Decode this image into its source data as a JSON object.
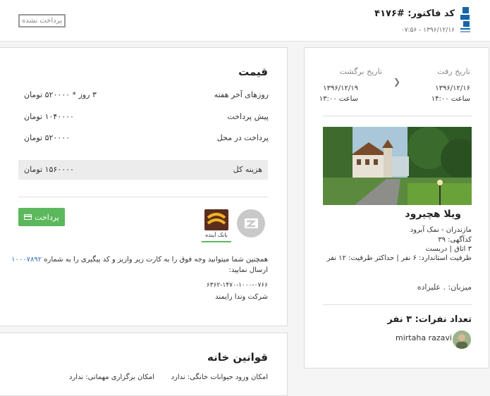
{
  "header": {
    "invoice_title": "کد فاکتور: #۴۱۷۶",
    "invoice_date": "۱۳۹۶/۱۲/۱۶ - ۰۷:۵۶",
    "status": "پرداخت نشده"
  },
  "price": {
    "title": "قیمت",
    "rows": [
      {
        "label": "روزهای آخر هفته",
        "value": "۳ روز * ۵۲۰۰۰۰ تومان"
      },
      {
        "label": "پیش پرداخت",
        "value": "۱۰۴۰۰۰۰ تومان"
      },
      {
        "label": "پرداخت در محل",
        "value": "۵۲۰۰۰۰ تومان"
      }
    ],
    "total_label": "هزینه کل",
    "total_value": "۱۵۶۰۰۰۰ تومان",
    "pay_button": "پرداخت",
    "bank_name": "بانک آینده",
    "note_line1_prefix": "همچنین شما میتوانید وجه فوق را به کارت زیر واریز و کد پیگیری را به شماره",
    "note_phone": "۱۰۰۰۷۸۹۲",
    "note_line2": "ارسال نمایید:",
    "card_number": "۶۳۶۲-۱۴۷۰-۱۰۰۰-۰۷۶۶",
    "company": "شرکت وندا رایمند"
  },
  "rules": {
    "title": "قوانین خانه",
    "pets": "امکان ورود حیوانات خانگی: ندارد",
    "party": "امکان برگزاری مهمانی: ندارد"
  },
  "trip": {
    "depart_label": "تاریخ رفت",
    "depart_date": "۱۳۹۶/۱۲/۱۶",
    "depart_time": "ساعت ۱۴:۰۰",
    "return_label": "تاریخ برگشت",
    "return_date": "۱۳۹۶/۱۲/۱۹",
    "return_time": "ساعت ۱۳:۰۰"
  },
  "villa": {
    "name": "ویلا هچیرود",
    "location": "مازندران - نمک آبرود",
    "ad_code": "کدآگهی: ۳۹",
    "rooms": "۳ اتاق | دربست",
    "capacity": "ظرفیت استاندارد: ۶ نفر | حداکثر ظرفیت: ۱۲ نفر",
    "host": "میزبان: . علیزاده"
  },
  "guests": {
    "count": "تعداد نفرات: ۳ نفر",
    "username": "mirtaha razavi"
  },
  "colors": {
    "pay_green": "#5cb85c",
    "link_blue": "#3b6fb6",
    "logo_blue": "#1565a8"
  }
}
